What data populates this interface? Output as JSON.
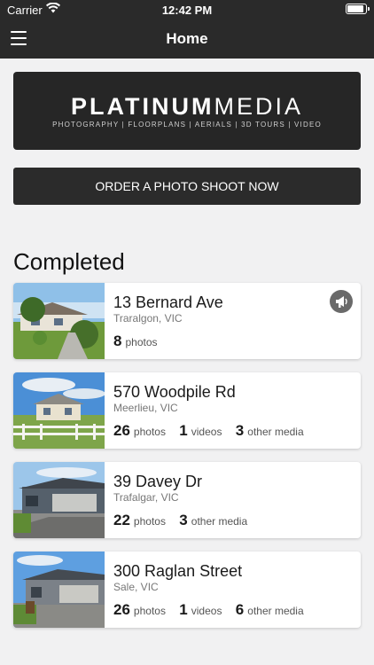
{
  "status": {
    "carrier": "Carrier",
    "time": "12:42 PM"
  },
  "nav": {
    "title": "Home"
  },
  "banner": {
    "brand_bold": "PLATINUM",
    "brand_light": "MEDIA",
    "tagline": "PHOTOGRAPHY | FLOORPLANS | AERIALS | 3D TOURS | VIDEO"
  },
  "order_button": "ORDER A PHOTO SHOOT NOW",
  "section_title": "Completed",
  "listings": [
    {
      "address": "13 Bernard Ave",
      "suburb": "Traralgon, VIC",
      "photos": "8",
      "videos": null,
      "other": null,
      "announce": true
    },
    {
      "address": "570 Woodpile Rd",
      "suburb": "Meerlieu, VIC",
      "photos": "26",
      "videos": "1",
      "other": "3",
      "announce": false
    },
    {
      "address": "39 Davey Dr",
      "suburb": "Trafalgar, VIC",
      "photos": "22",
      "videos": null,
      "other": "3",
      "announce": false
    },
    {
      "address": "300 Raglan Street",
      "suburb": "Sale, VIC",
      "photos": "26",
      "videos": "1",
      "other": "6",
      "announce": false
    }
  ],
  "labels": {
    "photos": "photos",
    "videos": "videos",
    "other": "other media"
  },
  "colors": {
    "header": "#2a2a2a",
    "background": "#f1f1f2"
  }
}
